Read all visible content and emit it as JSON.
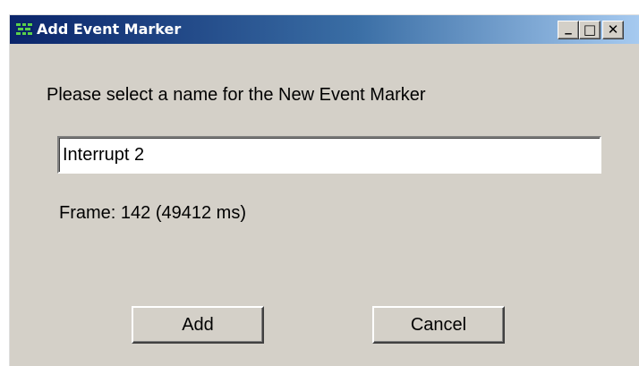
{
  "window": {
    "title": "Add Event Marker",
    "app_icon": "event-marker-app-icon",
    "controls": {
      "minimize_label": "_",
      "maximize_label": "□",
      "close_label": "✕"
    }
  },
  "dialog": {
    "prompt": "Please select a name for the New Event Marker",
    "name_field": {
      "value": "Interrupt 2"
    },
    "frame_info": "Frame: 142 (49412 ms)",
    "buttons": {
      "add_label": "Add",
      "cancel_label": "Cancel"
    }
  },
  "colors": {
    "dialog_face": "#d4d0c8",
    "title_gradient_start": "#0a246a",
    "title_gradient_end": "#a6caf0",
    "title_text": "#ffffff"
  }
}
